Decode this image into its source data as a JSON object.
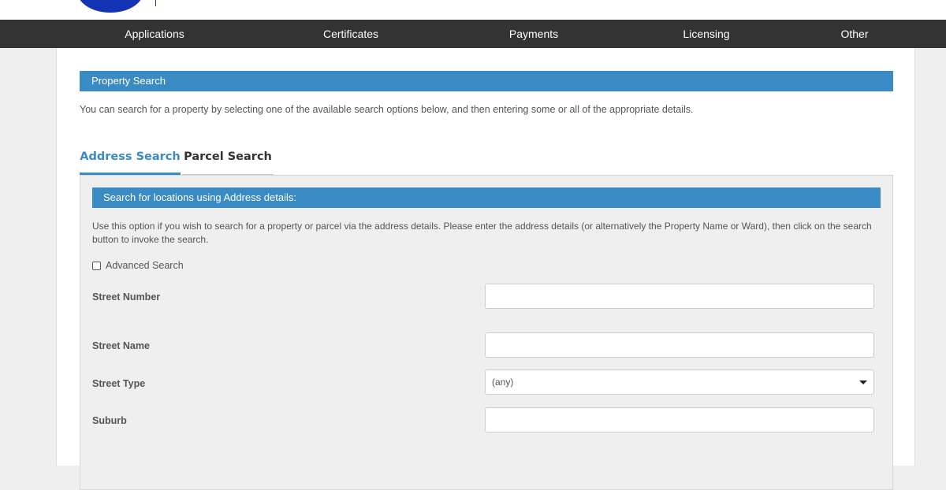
{
  "nav": {
    "items": [
      "Applications",
      "Certificates",
      "Payments",
      "Licensing",
      "Other"
    ]
  },
  "property_search": {
    "header": "Property Search",
    "intro": "You can search for a property by selecting one of the available search options below, and then entering some or all of the appropriate details."
  },
  "tabs": {
    "address": "Address Search",
    "parcel": "Parcel Search"
  },
  "address_panel": {
    "header": "Search for locations using Address details:",
    "description": "Use this option if you wish to search for a property or parcel via the address details. Please enter the address details (or alternatively the Property Name or Ward), then click on the search button to invoke the search.",
    "advanced_label": "Advanced Search",
    "advanced_checked": false,
    "fields": {
      "street_number": {
        "label": "Street Number",
        "value": ""
      },
      "street_name": {
        "label": "Street Name",
        "value": ""
      },
      "street_type": {
        "label": "Street Type",
        "selected": "(any)"
      },
      "suburb": {
        "label": "Suburb",
        "value": ""
      }
    }
  },
  "colors": {
    "accent": "#3a8ac4",
    "nav_bg": "#333333",
    "logo": "#1432b4"
  }
}
